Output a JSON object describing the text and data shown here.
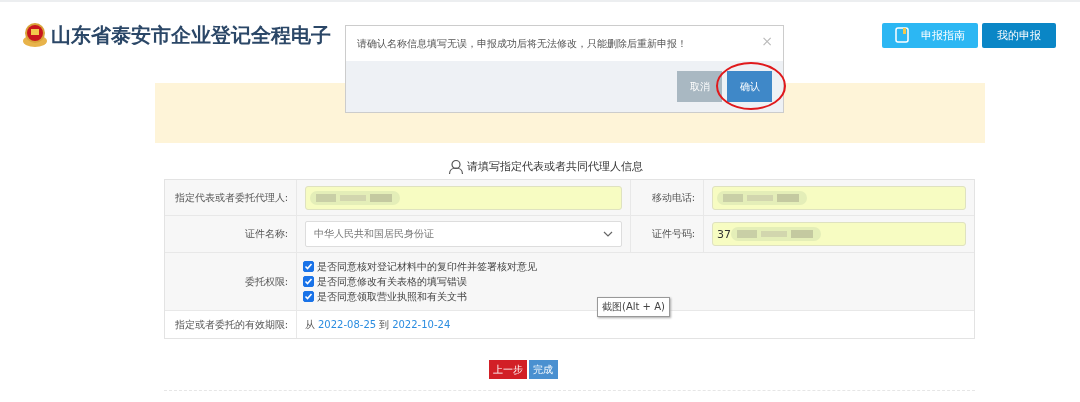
{
  "header": {
    "title": "山东省泰安市企业登记全程电子",
    "buttons": [
      {
        "label": "申报指南",
        "kind": "guide"
      },
      {
        "label": "我的申报",
        "kind": "primary"
      }
    ]
  },
  "dialog": {
    "message": "请确认名称信息填写无误，申报成功后将无法修改，只能删除后重新申报！",
    "close": "×",
    "buttons": [
      {
        "label": "取消",
        "kind": "cancel"
      },
      {
        "label": "确认",
        "kind": "confirm",
        "highlighted": true
      }
    ]
  },
  "section_title": "请填写指定代表或者共同代理人信息",
  "form": {
    "rows": [
      {
        "kind": "pair",
        "cells": [
          {
            "label": "指定代表或者委托代理人:",
            "kind": "input",
            "blurred": true
          },
          {
            "label": "移动电话:",
            "kind": "input",
            "blurred": true
          }
        ]
      },
      {
        "kind": "pair",
        "cells": [
          {
            "label": "证件名称:",
            "kind": "select",
            "value": "中华人民共和国居民身份证"
          },
          {
            "label": "证件号码:",
            "kind": "input",
            "value": "37",
            "blurred": true
          }
        ]
      },
      {
        "kind": "checks",
        "label": "委托权限:",
        "options": [
          {
            "text": "是否同意核对登记材料中的复印件并签署核对意见",
            "checked": true
          },
          {
            "text": "是否同意修改有关表格的填写错误",
            "checked": true
          },
          {
            "text": "是否同意领取营业执照和有关文书",
            "checked": true
          }
        ]
      },
      {
        "kind": "period",
        "label": "指定或者委托的有效期限:",
        "from_word": "从",
        "from": "2022-08-25",
        "to_word": "到",
        "to": "2022-10-24"
      }
    ]
  },
  "tooltip": "截图(Alt + A)",
  "actions": [
    {
      "label": "上一步",
      "kind": "back"
    },
    {
      "label": "完成",
      "kind": "finish"
    }
  ]
}
